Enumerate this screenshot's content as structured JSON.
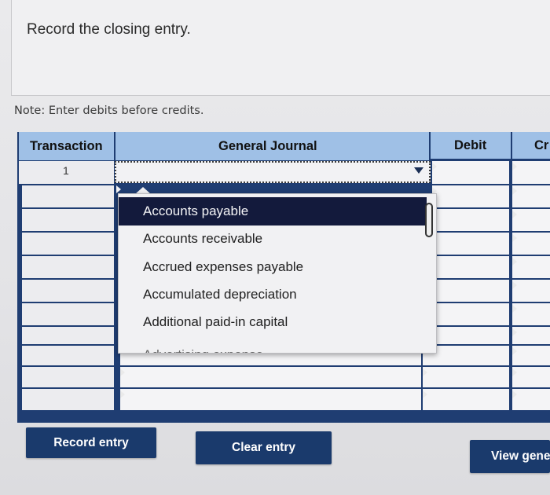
{
  "prompt": {
    "text": "Record the closing entry."
  },
  "note": {
    "text": "Note: Enter debits before credits."
  },
  "table": {
    "headers": {
      "transaction": "Transaction",
      "general_journal": "General Journal",
      "debit": "Debit",
      "credit": "Cr"
    },
    "rows": [
      {
        "transaction": "1"
      }
    ]
  },
  "dropdown": {
    "options": [
      "Accounts payable",
      "Accounts receivable",
      "Accrued expenses payable",
      "Accumulated depreciation",
      "Additional paid-in capital",
      "Advertising expense"
    ],
    "selected_index": 0
  },
  "buttons": {
    "record": "Record entry",
    "clear": "Clear entry",
    "view": "View gene"
  },
  "colors": {
    "header_bg": "#9fc0e6",
    "button_bg": "#1a3a6c",
    "grid_lines": "#1f3d72",
    "selected_option": "#131a3c"
  }
}
